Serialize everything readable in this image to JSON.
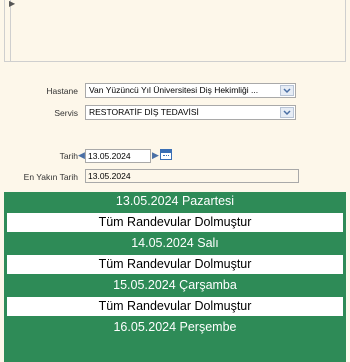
{
  "form": {
    "hastane_label": "Hastane",
    "hastane_value": "Van Yüzüncü Yıl Üniversitesi Diş Hekimliği ...",
    "servis_label": "Servis",
    "servis_value": "RESTORATİF DİŞ TEDAVİSİ",
    "tarih_label": "Tarih",
    "tarih_value": "13.05.2024",
    "en_yakin_label": "En Yakın Tarih",
    "en_yakin_value": "13.05.2024"
  },
  "days": [
    {
      "header": "13.05.2024 Pazartesi",
      "status": "Tüm Randevular Dolmuştur"
    },
    {
      "header": "14.05.2024 Salı",
      "status": "Tüm Randevular Dolmuştur"
    },
    {
      "header": "15.05.2024 Çarşamba",
      "status": "Tüm Randevular Dolmuştur"
    },
    {
      "header": "16.05.2024 Perşembe",
      "status": ""
    }
  ],
  "colors": {
    "accent": "#2e8b57",
    "background": "#fdf7ea"
  }
}
